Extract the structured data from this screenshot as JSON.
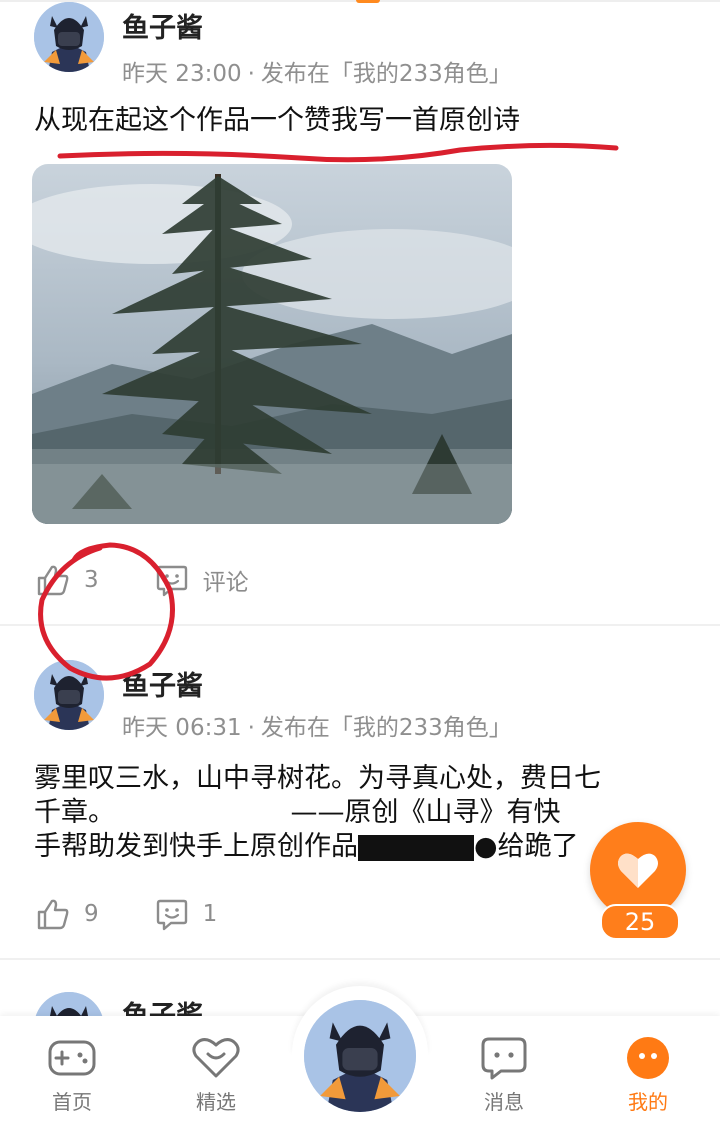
{
  "posts": [
    {
      "author": "鱼子酱",
      "time": "昨天 23:00",
      "dot": "·",
      "published_in": "发布在「我的233角色」",
      "text": "从现在起这个作品一个赞我写一首原创诗",
      "likes": "3",
      "comments": "评论"
    },
    {
      "author": "鱼子酱",
      "time": "昨天 06:31",
      "dot": "·",
      "published_in": "发布在「我的233角色」",
      "text_line1": "雾里叹三水，山中寻树花。为寻真心处，费日七",
      "text_line2": "千章。　　　　　　　——原创《山寻》有快",
      "text_line3": "手帮助发到快手上原创作品",
      "text_line3_end": "●给跪了",
      "likes": "9",
      "comments": "1"
    },
    {
      "author": "鱼子酱"
    }
  ],
  "fab": {
    "icon": "heart-icon",
    "count": "25"
  },
  "tabbar": {
    "items": [
      {
        "label": "首页",
        "icon": "gamepad-icon",
        "active": false
      },
      {
        "label": "精选",
        "icon": "heart-chat-icon",
        "active": false
      },
      {
        "label": "消息",
        "icon": "message-icon",
        "active": false
      },
      {
        "label": "我的",
        "icon": "profile-dots-icon",
        "active": true
      }
    ]
  },
  "colors": {
    "accent": "#ff7e1b",
    "annotation": "#d9202e",
    "muted": "#8f8f8f"
  }
}
